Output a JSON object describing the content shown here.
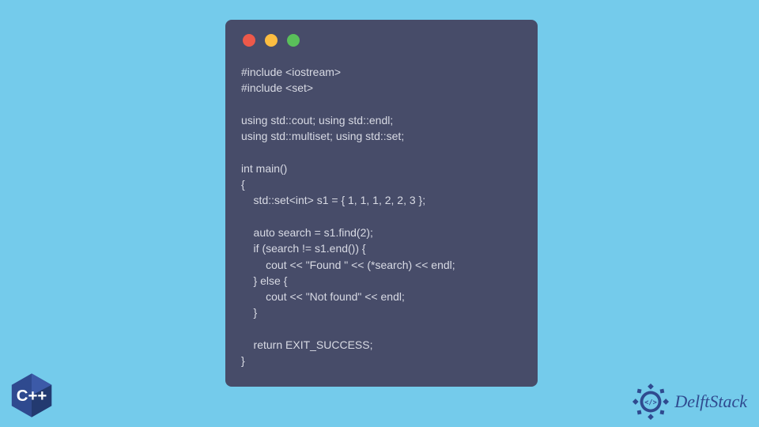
{
  "code_lines": [
    "#include <iostream>",
    "#include <set>",
    "",
    "using std::cout; using std::endl;",
    "using std::multiset; using std::set;",
    "",
    "int main()",
    "{",
    "    std::set<int> s1 = { 1, 1, 1, 2, 2, 3 };",
    "",
    "    auto search = s1.find(2);",
    "    if (search != s1.end()) {",
    "        cout << \"Found \" << (*search) << endl;",
    "    } else {",
    "        cout << \"Not found\" << endl;",
    "    }",
    "",
    "    return EXIT_SUCCESS;",
    "}"
  ],
  "brand": {
    "name": "DelftStack",
    "cpp_label": "C++"
  },
  "colors": {
    "window_bg": "#474c69",
    "page_bg": "#74cbeb",
    "code_text": "#d8dae4",
    "red": "#ed594a",
    "yellow": "#fdbd41",
    "green": "#5ac05a",
    "brand_blue": "#2f4a8f"
  }
}
